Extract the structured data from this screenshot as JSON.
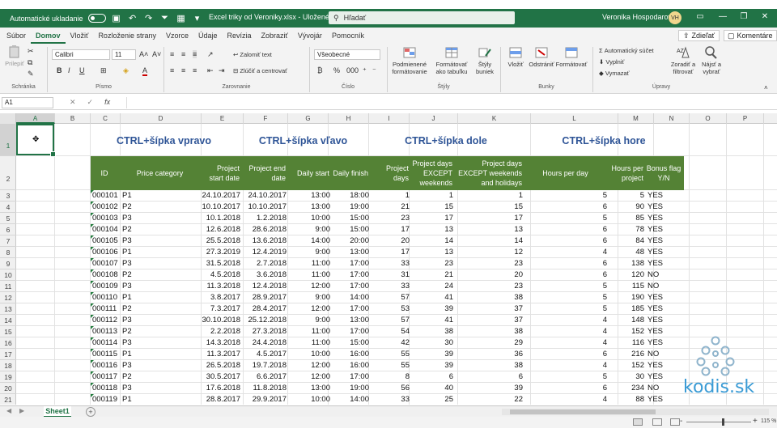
{
  "titlebar": {
    "autosave_label": "Automatické ukladanie",
    "document_title": "Excel triky od Veroniky.xlsx - Uložené",
    "search_placeholder": "Hľadať",
    "user_name": "Veronika Hospodarova",
    "user_initials": "VH"
  },
  "tabs": [
    "Súbor",
    "Domov",
    "Vložiť",
    "Rozloženie strany",
    "Vzorce",
    "Údaje",
    "Revízia",
    "Zobraziť",
    "Vývojár",
    "Pomocník"
  ],
  "active_tab": "Domov",
  "share_label": "Zdieľať",
  "comments_label": "Komentáre",
  "ribbon": {
    "clipboard": {
      "paste": "Prilepiť",
      "group": "Schránka"
    },
    "font": {
      "name": "Calibri",
      "size": "11",
      "group": "Písmo"
    },
    "alignment": {
      "wrap": "Zalomiť text",
      "merge": "Zlúčiť a centrovať",
      "group": "Zarovnanie"
    },
    "number": {
      "format": "Všeobecné",
      "group": "Číslo"
    },
    "styles": {
      "conditional": "Podmienené formátovanie",
      "table": "Formátovať ako tabuľku",
      "cell_styles": "Štýly buniek",
      "group": "Štýly"
    },
    "cells": {
      "insert": "Vložiť",
      "delete": "Odstrániť",
      "format": "Formátovať",
      "group": "Bunky"
    },
    "editing": {
      "autosum": "Automatický súčet",
      "fill": "Vyplniť",
      "clear": "Vymazať",
      "sort": "Zoradiť a filtrovať",
      "find": "Nájsť a vybrať",
      "group": "Úpravy"
    }
  },
  "namebox": "A1",
  "columns": [
    "A",
    "B",
    "C",
    "D",
    "E",
    "F",
    "G",
    "H",
    "I",
    "J",
    "K",
    "L",
    "M",
    "N",
    "O",
    "P"
  ],
  "section_titles": [
    "CTRL+šípka vpravo",
    "CTRL+šípka vľavo",
    "CTRL+šípka dole",
    "CTRL+šípka hore"
  ],
  "headers": [
    "ID",
    "Price category",
    "Project start date",
    "Project end date",
    "Daily start",
    "Daily finish",
    "Project days",
    "Project days EXCEPT weekends",
    "Project days EXCEPT weekends and holidays",
    "Hours per day",
    "Hours per project",
    "Bonus flag Y/N"
  ],
  "row_numbers": [
    "1",
    "2",
    "3",
    "4",
    "5",
    "6",
    "7",
    "8",
    "9",
    "10",
    "11",
    "12",
    "13",
    "14",
    "15",
    "16",
    "17",
    "18",
    "19",
    "20",
    "21"
  ],
  "rows": [
    [
      "000101",
      "P1",
      "24.10.2017",
      "24.10.2017",
      "13:00",
      "18:00",
      "1",
      "1",
      "1",
      "5",
      "5",
      "YES"
    ],
    [
      "000102",
      "P2",
      "10.10.2017",
      "10.10.2017",
      "13:00",
      "19:00",
      "21",
      "15",
      "15",
      "6",
      "90",
      "YES"
    ],
    [
      "000103",
      "P3",
      "10.1.2018",
      "1.2.2018",
      "10:00",
      "15:00",
      "23",
      "17",
      "17",
      "5",
      "85",
      "YES"
    ],
    [
      "000104",
      "P2",
      "12.6.2018",
      "28.6.2018",
      "9:00",
      "15:00",
      "17",
      "13",
      "13",
      "6",
      "78",
      "YES"
    ],
    [
      "000105",
      "P3",
      "25.5.2018",
      "13.6.2018",
      "14:00",
      "20:00",
      "20",
      "14",
      "14",
      "6",
      "84",
      "YES"
    ],
    [
      "000106",
      "P1",
      "27.3.2019",
      "12.4.2019",
      "9:00",
      "13:00",
      "17",
      "13",
      "12",
      "4",
      "48",
      "YES"
    ],
    [
      "000107",
      "P3",
      "31.5.2018",
      "2.7.2018",
      "11:00",
      "17:00",
      "33",
      "23",
      "23",
      "6",
      "138",
      "YES"
    ],
    [
      "000108",
      "P2",
      "4.5.2018",
      "3.6.2018",
      "11:00",
      "17:00",
      "31",
      "21",
      "20",
      "6",
      "120",
      "NO"
    ],
    [
      "000109",
      "P3",
      "11.3.2018",
      "12.4.2018",
      "12:00",
      "17:00",
      "33",
      "24",
      "23",
      "5",
      "115",
      "NO"
    ],
    [
      "000110",
      "P1",
      "3.8.2017",
      "28.9.2017",
      "9:00",
      "14:00",
      "57",
      "41",
      "38",
      "5",
      "190",
      "YES"
    ],
    [
      "000111",
      "P2",
      "7.3.2017",
      "28.4.2017",
      "12:00",
      "17:00",
      "53",
      "39",
      "37",
      "5",
      "185",
      "YES"
    ],
    [
      "000112",
      "P3",
      "30.10.2018",
      "25.12.2018",
      "9:00",
      "13:00",
      "57",
      "41",
      "37",
      "4",
      "148",
      "YES"
    ],
    [
      "000113",
      "P2",
      "2.2.2018",
      "27.3.2018",
      "11:00",
      "17:00",
      "54",
      "38",
      "38",
      "4",
      "152",
      "YES"
    ],
    [
      "000114",
      "P3",
      "14.3.2018",
      "24.4.2018",
      "11:00",
      "15:00",
      "42",
      "30",
      "29",
      "4",
      "116",
      "YES"
    ],
    [
      "000115",
      "P1",
      "11.3.2017",
      "4.5.2017",
      "10:00",
      "16:00",
      "55",
      "39",
      "36",
      "6",
      "216",
      "NO"
    ],
    [
      "000116",
      "P3",
      "26.5.2018",
      "19.7.2018",
      "12:00",
      "16:00",
      "55",
      "39",
      "38",
      "4",
      "152",
      "YES"
    ],
    [
      "000117",
      "P2",
      "30.5.2017",
      "6.6.2017",
      "12:00",
      "17:00",
      "8",
      "6",
      "6",
      "5",
      "30",
      "YES"
    ],
    [
      "000118",
      "P3",
      "17.6.2018",
      "11.8.2018",
      "13:00",
      "19:00",
      "56",
      "40",
      "39",
      "6",
      "234",
      "NO"
    ],
    [
      "000119",
      "P1",
      "28.8.2017",
      "29.9.2017",
      "10:00",
      "14:00",
      "33",
      "25",
      "22",
      "4",
      "88",
      "YES"
    ]
  ],
  "sheet_name": "Sheet1",
  "zoom": "115 %",
  "logo_text": "kodis.sk"
}
